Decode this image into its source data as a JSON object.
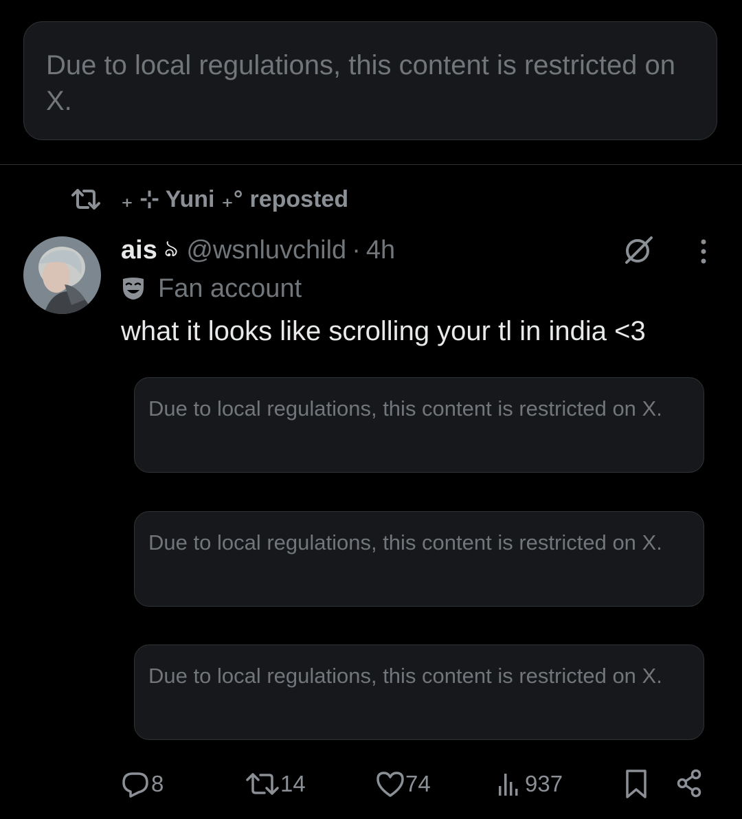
{
  "restricted_notice_top": "Due to local regulations, this content is restricted on X.",
  "repost": {
    "icon": "repost-icon",
    "reposter": "₊ ⊹ Yuni ₊°",
    "suffix": "reposted"
  },
  "post": {
    "author_name": "ais",
    "author_emoji": "ঌ",
    "handle": "@wsnluvchild",
    "separator": "·",
    "time": "4h",
    "label_icon": "mask-icon",
    "label": "Fan account",
    "text": "what it looks like scrolling your tl in india <3",
    "restricted_cards": [
      "Due to local regulations, this content is restricted on X.",
      "Due to local regulations, this content is restricted on X.",
      "Due to local regulations, this content is restricted on X."
    ]
  },
  "actions": {
    "replies": "8",
    "reposts": "14",
    "likes": "74",
    "views": "937"
  },
  "colors": {
    "background": "#000000",
    "card": "#16181c",
    "border": "#2f3336",
    "muted_text": "#71767b",
    "primary_text": "#e7e9ea"
  }
}
